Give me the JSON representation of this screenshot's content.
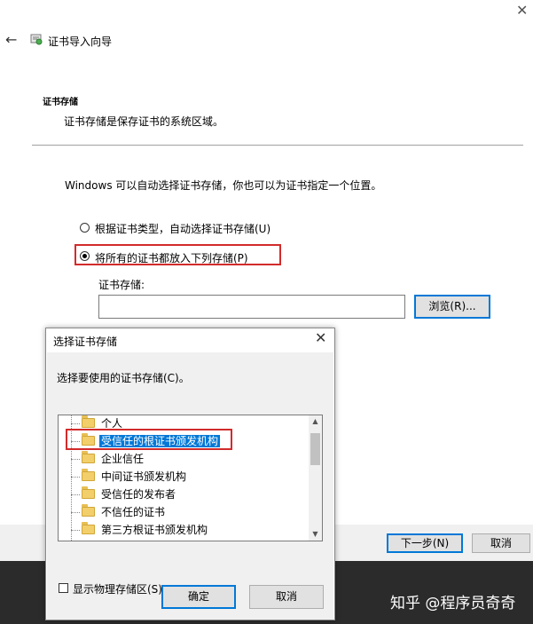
{
  "wizard": {
    "title": "证书导入向导",
    "close_glyph": "✕",
    "back_glyph": "←",
    "section_title": "证书存储",
    "section_desc": "证书存储是保存证书的系统区域。",
    "intro": "Windows 可以自动选择证书存储，你也可以为证书指定一个位置。",
    "radio_auto": "根据证书类型，自动选择证书存储(U)",
    "radio_manual": "将所有的证书都放入下列存储(P)",
    "store_label": "证书存储:",
    "store_value": "",
    "browse_label": "浏览(R)...",
    "next_label": "下一步(N)",
    "cancel_label": "取消"
  },
  "dialog": {
    "title": "选择证书存储",
    "close_glyph": "✕",
    "prompt": "选择要使用的证书存储(C)。",
    "tree_items": [
      "个人",
      "受信任的根证书颁发机构",
      "企业信任",
      "中间证书颁发机构",
      "受信任的发布者",
      "不信任的证书",
      "第三方根证书颁发机构"
    ],
    "selected_index": 1,
    "show_physical": "显示物理存储区(S)",
    "ok_label": "确定",
    "cancel_label": "取消"
  },
  "watermark": "知乎 @程序员奇奇",
  "colors": {
    "highlight": "#0078d7",
    "annotation": "#d22b2b",
    "dark_bar": "#2b2b2b"
  }
}
